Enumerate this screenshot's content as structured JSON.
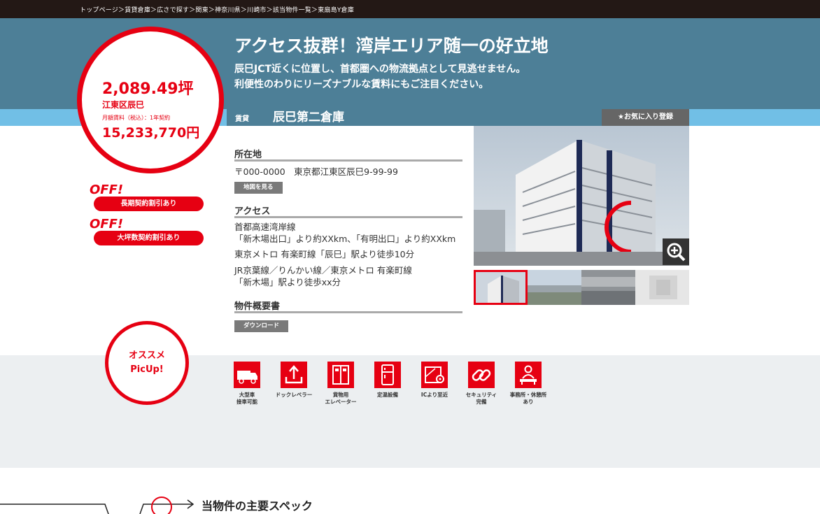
{
  "breadcrumb": "トップページ＞賃貸倉庫＞広さで探す＞関東＞神奈川県＞川崎市＞該当物件一覧＞東扇島Y倉庫",
  "hero": {
    "title": "アクセス抜群！湾岸エリア随一の好立地",
    "subtitle_1": "辰巳JCT近くに位置し、首都圏への物流拠点として見逃せません。",
    "subtitle_2": "利便性のわりにリーズナブルな賃料にもご注目ください。"
  },
  "summary": {
    "area": "2,089.49坪",
    "location": "江東区辰巳",
    "rent_label": "月額賃料（税込）：1年契約",
    "rent": "15,233,770円"
  },
  "offers": [
    {
      "badge": "OFF!",
      "label": "長期契約割引あり"
    },
    {
      "badge": "OFF!",
      "label": "大坪数契約割引あり"
    }
  ],
  "property": {
    "type": "賃貸",
    "name": "辰巳第二倉庫",
    "favorite_label": "★お気に入り登録"
  },
  "location_section": {
    "heading": "所在地",
    "address": "〒000-0000　東京都江東区辰巳9-99-99",
    "map_button": "地図を見る"
  },
  "access_section": {
    "heading": "アクセス",
    "lines": [
      "首都高速湾岸線",
      "「新木場出口」より約XXkm、「有明出口」より約XXkm",
      "東京メトロ 有楽町線「辰巳」駅より徒歩10分",
      "JR京葉線／りんかい線／東京メトロ 有楽町線",
      "「新木場」駅より徒歩xx分"
    ]
  },
  "docs_section": {
    "heading": "物件概要書",
    "download_button": "ダウンロード"
  },
  "pickup": {
    "line1": "オススメ",
    "line2": "PicUp!"
  },
  "features": [
    {
      "icon": "truck-icon",
      "line1": "大型車",
      "line2": "接車可能"
    },
    {
      "icon": "dock-leveler-icon",
      "line1": "ドックレベラー",
      "line2": ""
    },
    {
      "icon": "elevator-icon",
      "line1": "貨物用",
      "line2": "エレベーター"
    },
    {
      "icon": "refrigerator-icon",
      "line1": "定温設備",
      "line2": ""
    },
    {
      "icon": "map-pin-icon",
      "line1": "ICより至近",
      "line2": ""
    },
    {
      "icon": "chain-link-icon",
      "line1": "セキュリティ",
      "line2": "完備"
    },
    {
      "icon": "office-worker-icon",
      "line1": "事務所・休憩所",
      "line2": "あり"
    }
  ],
  "spec_title": "当物件の主要スペック",
  "colors": {
    "accent": "#e60012",
    "hero": "#4d7f97",
    "strip": "#71bfe6",
    "topbar": "#231815"
  }
}
